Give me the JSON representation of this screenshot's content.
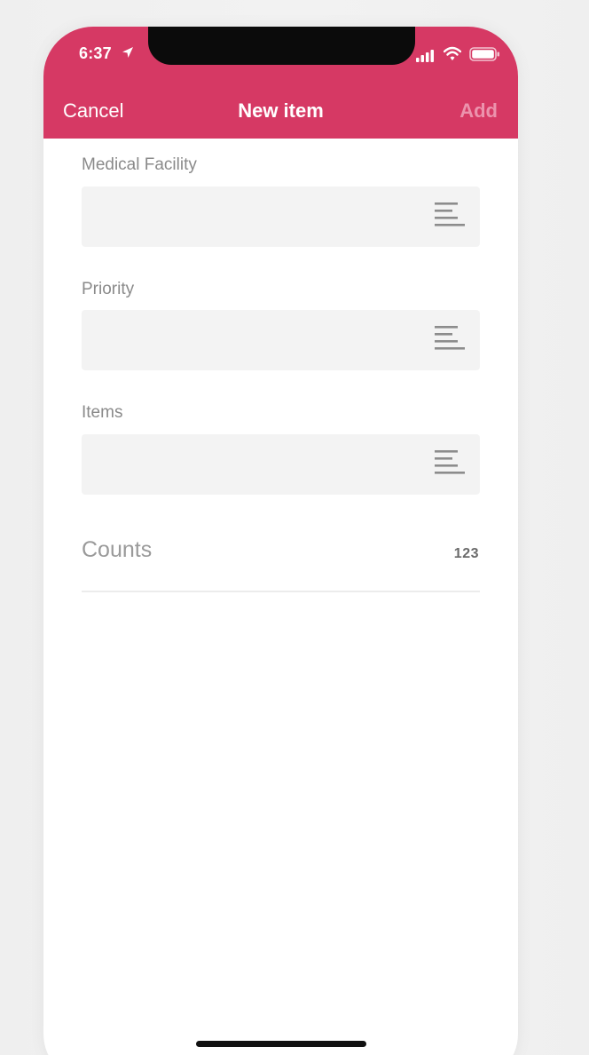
{
  "status_bar": {
    "time": "6:37",
    "icons": [
      "location-arrow-icon",
      "signal-icon",
      "wifi-icon",
      "battery-icon"
    ]
  },
  "nav": {
    "cancel_label": "Cancel",
    "title": "New item",
    "add_label": "Add"
  },
  "form": {
    "fields": [
      {
        "label": "Medical Facility",
        "value": "",
        "icon": "list-icon"
      },
      {
        "label": "Priority",
        "value": "",
        "icon": "list-icon"
      },
      {
        "label": "Items",
        "value": "",
        "icon": "list-icon"
      }
    ],
    "counts": {
      "label": "Counts",
      "value": "123"
    }
  },
  "colors": {
    "header_background": "#d63964",
    "add_disabled": "#ec93ad",
    "field_background": "#f3f3f3"
  }
}
